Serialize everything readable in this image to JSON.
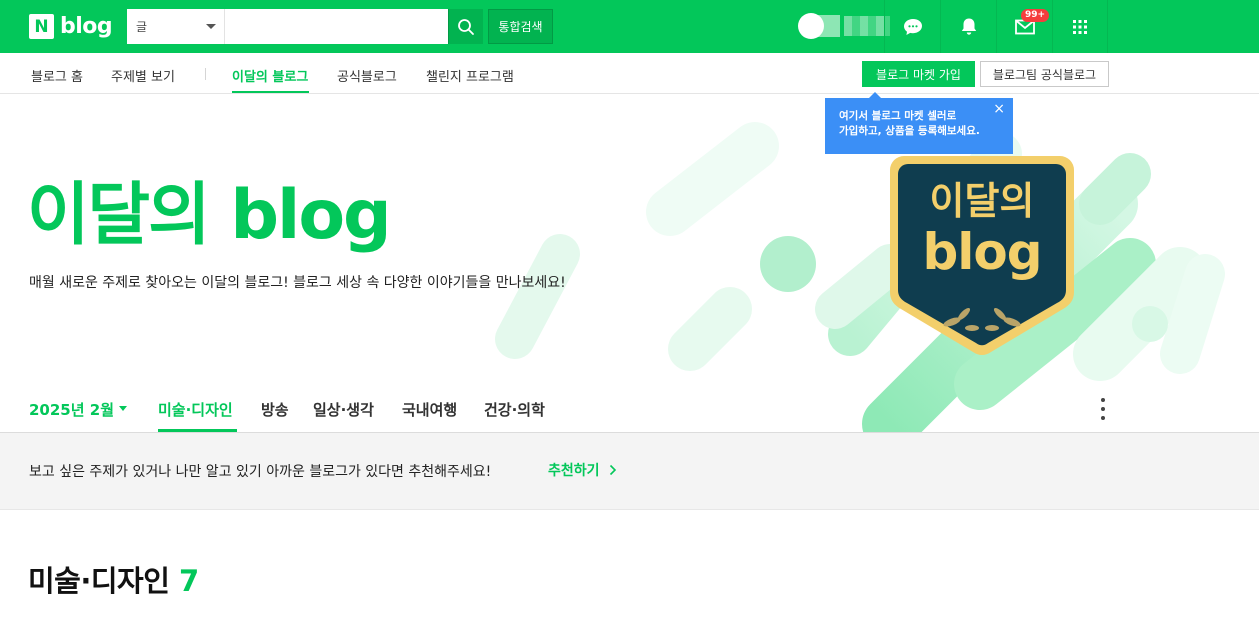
{
  "header": {
    "logo_mark": "N",
    "logo_text": "blog",
    "search_category": "글",
    "search_placeholder": "",
    "search_button_label": "통합검색",
    "notification_badge": "99+"
  },
  "subnav": {
    "items": [
      "블로그 홈",
      "주제별 보기",
      "이달의 블로그",
      "공식블로그",
      "챌린지 프로그램"
    ],
    "market_button": "블로그 마켓 가입",
    "official_button": "블로그팀 공식블로그"
  },
  "tooltip": {
    "line1": "여기서 블로그 마켓 셀러로",
    "line2": "가입하고, 상품을 등록해보세요.",
    "close": "×"
  },
  "hero": {
    "title": "이달의 blog",
    "subtitle": "매월 새로운 주제로 찾아오는 이달의 블로그! 블로그 세상 속 다양한 이야기들을 만나보세요!",
    "badge_line1": "이달의",
    "badge_line2": "blog"
  },
  "categories": {
    "month": "2025년 2월",
    "tabs": [
      "미술·디자인",
      "방송",
      "일상·생각",
      "국내여행",
      "건강·의학"
    ]
  },
  "recommend": {
    "text": "보고 싶은 주제가 있거나 나만 알고 있기 아까운 블로그가 있다면 추천해주세요!",
    "link": "추천하기"
  },
  "section": {
    "title": "미술·디자인",
    "count": "7"
  },
  "colors": {
    "brand_green": "#03c75a",
    "tooltip_blue": "#3b8ff6",
    "badge_red": "#f53d3d",
    "badge_navy": "#0f3d4f",
    "badge_gold": "#f3cf6b"
  }
}
